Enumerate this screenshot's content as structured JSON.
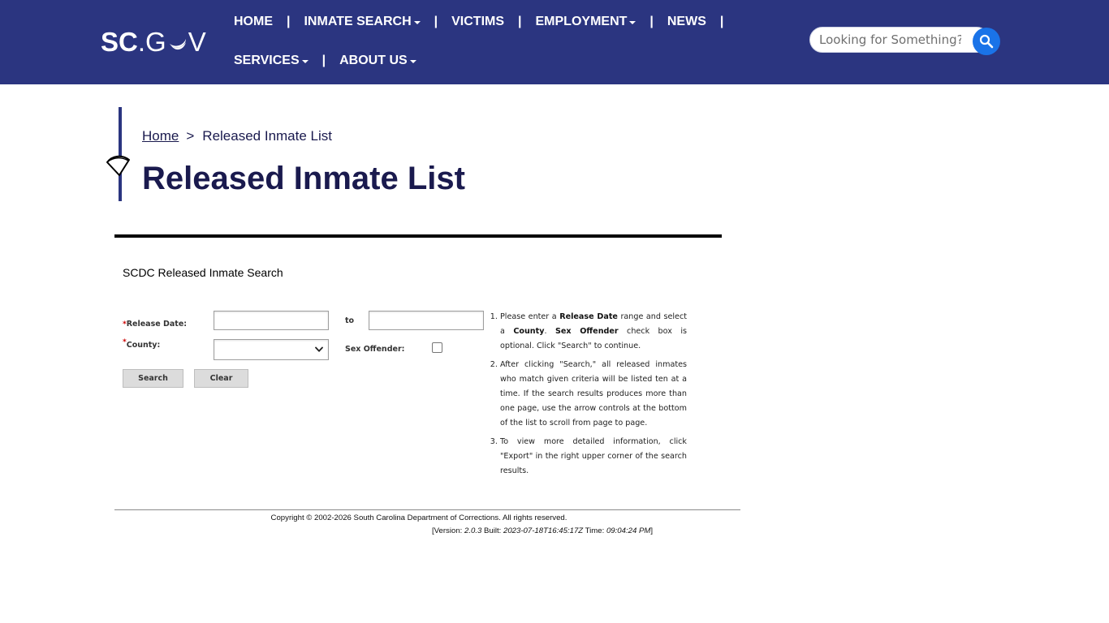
{
  "header": {
    "logo": {
      "sc": "SC",
      "dot": ".",
      "g": "G",
      "v": "V",
      "moon_icon": "crescent-moon-icon"
    },
    "nav_row1": [
      {
        "label": "HOME",
        "dropdown": false
      },
      {
        "label": "INMATE SEARCH",
        "dropdown": true
      },
      {
        "label": "VICTIMS",
        "dropdown": false
      },
      {
        "label": "EMPLOYMENT",
        "dropdown": true
      },
      {
        "label": "NEWS",
        "dropdown": false
      }
    ],
    "nav_row2": [
      {
        "label": "SERVICES",
        "dropdown": true
      },
      {
        "label": "ABOUT US",
        "dropdown": true
      }
    ],
    "separator": "|",
    "search": {
      "placeholder": "Looking for Something?",
      "button_icon": "search-icon"
    },
    "bg_color": "#2b3580"
  },
  "breadcrumb": {
    "home": "Home",
    "separator": ">",
    "current": "Released Inmate List"
  },
  "page": {
    "title": "Released Inmate List",
    "title_color": "#1a1a4e"
  },
  "form": {
    "heading": "SCDC Released Inmate Search",
    "required_marker": "*",
    "release_date_label": "Release Date:",
    "to_label": "to",
    "release_date_from": "",
    "release_date_to": "",
    "county_label": "County:",
    "county_value": "",
    "sex_offender_label": "Sex Offender:",
    "sex_offender_checked": false,
    "search_button": "Search",
    "clear_button": "Clear"
  },
  "instructions": {
    "item1": {
      "a": "Please enter a ",
      "b1": "Release Date",
      "c": " range and select a ",
      "b2": "County",
      "d": ". ",
      "b3": "Sex Offender",
      "e": " check box is optional. Click \"Search\" to continue."
    },
    "item2": "After clicking \"Search,\" all released inmates who match given criteria will be listed ten at a time. If the search results produces more than one page, use the arrow controls at the bottom of the list to scroll from page to page.",
    "item3": "To view more detailed information, click \"Export\" in the right upper corner of the search results."
  },
  "footer": {
    "copyright": "Copyright © 2002-2026 South Carolina Department of Corrections. All rights reserved.",
    "version_prefix": "[Version: ",
    "version": "2.0.3",
    "built_label": " Built: ",
    "built": "2023-07-18T16:45:17Z",
    "time_label": " Time: ",
    "time": "09:04:24 PM",
    "version_suffix": "]"
  }
}
